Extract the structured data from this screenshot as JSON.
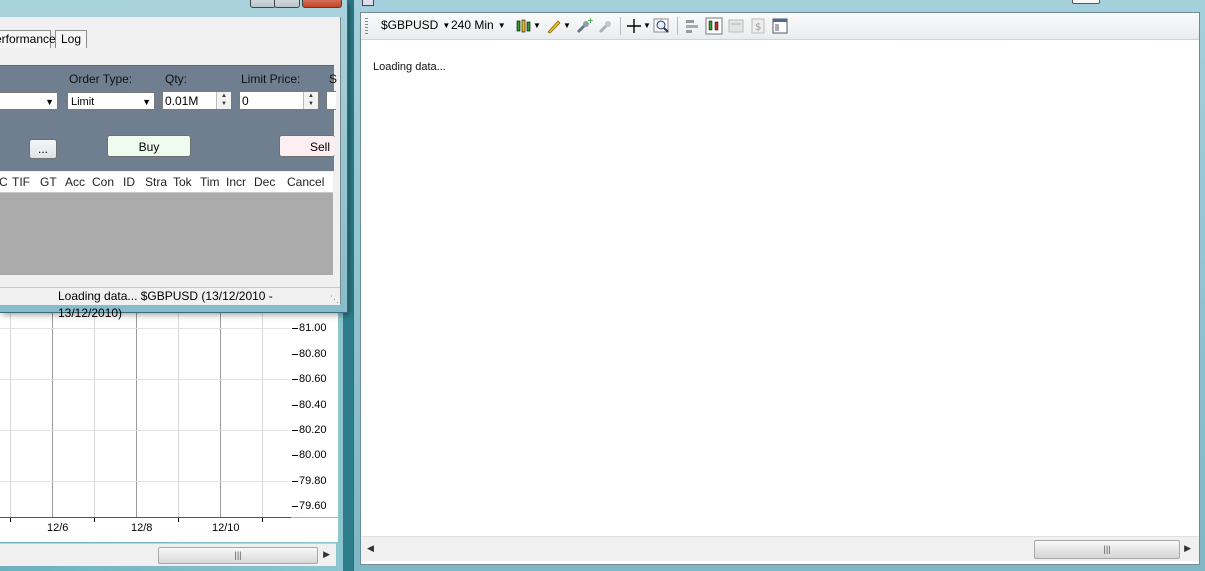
{
  "order_window": {
    "tabs": [
      "erformance",
      "Log"
    ],
    "labels": {
      "order_type": "Order Type:",
      "qty": "Qty:",
      "limit_price": "Limit Price:",
      "cut": "S"
    },
    "order_type_value": "Limit",
    "qty_value": "0.01M",
    "limit_price_value": "0",
    "ellipsis_label": "...",
    "buy_label": "Buy",
    "sell_label": "Sell",
    "columns": [
      "C",
      "TIF",
      "GT",
      "Acc",
      "Con",
      "ID",
      "Stra",
      "Tok",
      "Tim",
      "Incr",
      "Dec",
      "Cancel"
    ],
    "status_text": "Loading data... $GBPUSD  (13/12/2010 - 13/12/2010)"
  },
  "background_chart": {
    "y_ticks": [
      "81.00",
      "80.80",
      "80.60",
      "80.40",
      "80.20",
      "80.00",
      "79.80",
      "79.60"
    ],
    "x_ticks": [
      "12/6",
      "12/8",
      "12/10"
    ]
  },
  "main_chart_window": {
    "toolbar": {
      "instrument": "$GBPUSD",
      "interval": "240 Min"
    },
    "loading_message": "Loading data..."
  },
  "colors": {
    "buy_bg": "#eefbee",
    "sell_bg": "#fdeef2",
    "ticket_bg": "#707f8f",
    "orders_grid_bg": "#ababab"
  },
  "icons": [
    "candlestick-icon",
    "pencil-icon",
    "add-indicator-icon",
    "remove-indicator-icon",
    "crosshair-icon",
    "zoom-icon",
    "align-icon",
    "chart-style-icon",
    "template-icon",
    "dollar-icon",
    "properties-icon"
  ]
}
